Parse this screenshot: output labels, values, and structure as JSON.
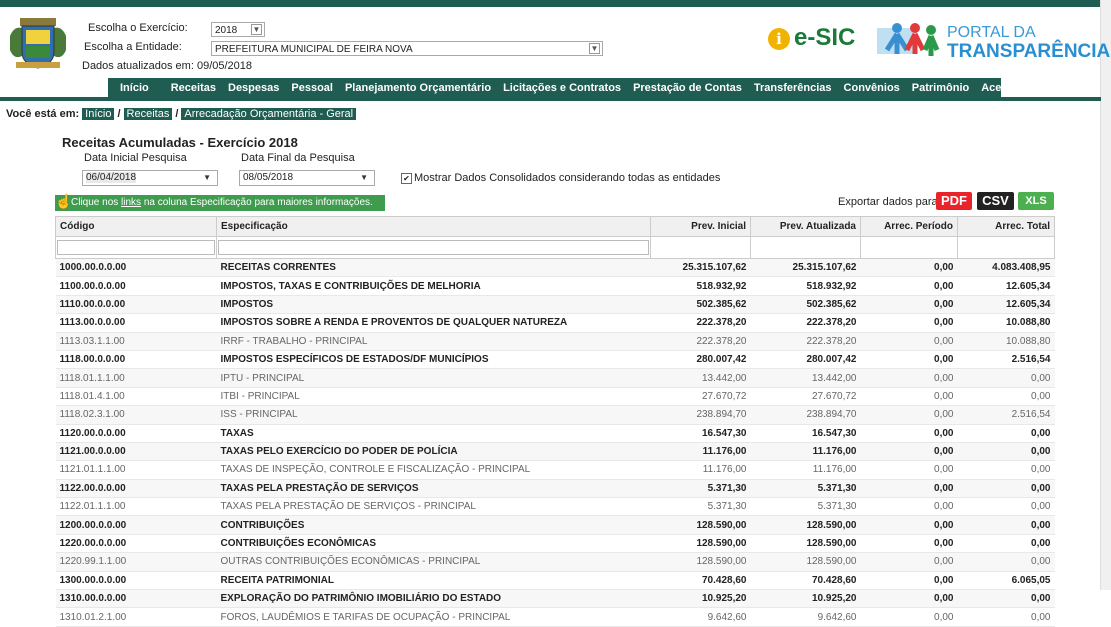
{
  "header": {
    "exercicio_label": "Escolha o Exercício:",
    "exercicio_value": "2018",
    "entidade_label": "Escolha a Entidade:",
    "entidade_value": "PREFEITURA MUNICIPAL DE FEIRA NOVA",
    "updated": "Dados atualizados em: 09/05/2018",
    "esic": "e-SIC",
    "portal_line1": "PORTAL DA",
    "portal_line2": "TRANSPARÊNCIA"
  },
  "nav": [
    "Início",
    "Receitas",
    "Despesas",
    "Pessoal",
    "Planejamento Orçamentário",
    "Licitações e Contratos",
    "Prestação de Contas",
    "Transferências",
    "Convênios",
    "Patrimônio",
    "Acesso à Informação"
  ],
  "breadcrumb": {
    "label": "Você está em:",
    "items": [
      "Início",
      "Receitas",
      "Arrecadação Orçamentária - Geral"
    ]
  },
  "page": {
    "title": "Receitas Acumuladas - Exercício 2018",
    "data_inicial_label": "Data Inicial Pesquisa",
    "data_inicial": "06/04/2018",
    "data_final_label": "Data Final da Pesquisa",
    "data_final": "08/05/2018",
    "consolidado_label": "Mostrar Dados Consolidados considerando todas as entidades",
    "hint_pre": "Clique nos ",
    "hint_link": "links",
    "hint_post": " na coluna Especificação para maiores informações.",
    "export_label": "Exportar dados para:",
    "pdf": "PDF",
    "csv": "CSV",
    "xls": "XLS"
  },
  "colors": {
    "brand": "#1f5c52",
    "hint": "#3f9b4d",
    "pdf": "#e8232a",
    "csv": "#222222",
    "xls": "#4caf50"
  },
  "table": {
    "headers": [
      "Código",
      "Especificação",
      "Prev. Inicial",
      "Prev. Atualizada",
      "Arrec. Período",
      "Arrec. Total"
    ],
    "rows": [
      {
        "b": true,
        "c": [
          "1000.00.0.0.00",
          "RECEITAS CORRENTES",
          "25.315.107,62",
          "25.315.107,62",
          "0,00",
          "4.083.408,95"
        ]
      },
      {
        "b": true,
        "c": [
          "1100.00.0.0.00",
          "IMPOSTOS, TAXAS E CONTRIBUIÇÕES DE MELHORIA",
          "518.932,92",
          "518.932,92",
          "0,00",
          "12.605,34"
        ]
      },
      {
        "b": true,
        "c": [
          "1110.00.0.0.00",
          "IMPOSTOS",
          "502.385,62",
          "502.385,62",
          "0,00",
          "12.605,34"
        ]
      },
      {
        "b": true,
        "c": [
          "1113.00.0.0.00",
          "IMPOSTOS SOBRE A RENDA E PROVENTOS DE QUALQUER NATUREZA",
          "222.378,20",
          "222.378,20",
          "0,00",
          "10.088,80"
        ]
      },
      {
        "b": false,
        "c": [
          "1113.03.1.1.00",
          "IRRF - TRABALHO - PRINCIPAL",
          "222.378,20",
          "222.378,20",
          "0,00",
          "10.088,80"
        ]
      },
      {
        "b": true,
        "c": [
          "1118.00.0.0.00",
          "IMPOSTOS ESPECÍFICOS DE ESTADOS/DF MUNICÍPIOS",
          "280.007,42",
          "280.007,42",
          "0,00",
          "2.516,54"
        ]
      },
      {
        "b": false,
        "c": [
          "1118.01.1.1.00",
          "IPTU - PRINCIPAL",
          "13.442,00",
          "13.442,00",
          "0,00",
          "0,00"
        ]
      },
      {
        "b": false,
        "c": [
          "1118.01.4.1.00",
          "ITBI - PRINCIPAL",
          "27.670,72",
          "27.670,72",
          "0,00",
          "0,00"
        ]
      },
      {
        "b": false,
        "c": [
          "1118.02.3.1.00",
          "ISS - PRINCIPAL",
          "238.894,70",
          "238.894,70",
          "0,00",
          "2.516,54"
        ]
      },
      {
        "b": true,
        "c": [
          "1120.00.0.0.00",
          "TAXAS",
          "16.547,30",
          "16.547,30",
          "0,00",
          "0,00"
        ]
      },
      {
        "b": true,
        "c": [
          "1121.00.0.0.00",
          "TAXAS PELO EXERCÍCIO DO PODER DE POLÍCIA",
          "11.176,00",
          "11.176,00",
          "0,00",
          "0,00"
        ]
      },
      {
        "b": false,
        "c": [
          "1121.01.1.1.00",
          "TAXAS DE INSPEÇÃO, CONTROLE E FISCALIZAÇÃO - PRINCIPAL",
          "11.176,00",
          "11.176,00",
          "0,00",
          "0,00"
        ]
      },
      {
        "b": true,
        "c": [
          "1122.00.0.0.00",
          "TAXAS PELA PRESTAÇÃO DE SERVIÇOS",
          "5.371,30",
          "5.371,30",
          "0,00",
          "0,00"
        ]
      },
      {
        "b": false,
        "c": [
          "1122.01.1.1.00",
          "TAXAS PELA PRESTAÇÃO DE SERVIÇOS - PRINCIPAL",
          "5.371,30",
          "5.371,30",
          "0,00",
          "0,00"
        ]
      },
      {
        "b": true,
        "c": [
          "1200.00.0.0.00",
          "CONTRIBUIÇÕES",
          "128.590,00",
          "128.590,00",
          "0,00",
          "0,00"
        ]
      },
      {
        "b": true,
        "c": [
          "1220.00.0.0.00",
          "CONTRIBUIÇÕES ECONÔMICAS",
          "128.590,00",
          "128.590,00",
          "0,00",
          "0,00"
        ]
      },
      {
        "b": false,
        "c": [
          "1220.99.1.1.00",
          "OUTRAS CONTRIBUIÇÕES ECONÔMICAS - PRINCIPAL",
          "128.590,00",
          "128.590,00",
          "0,00",
          "0,00"
        ]
      },
      {
        "b": true,
        "c": [
          "1300.00.0.0.00",
          "RECEITA PATRIMONIAL",
          "70.428,60",
          "70.428,60",
          "0,00",
          "6.065,05"
        ]
      },
      {
        "b": true,
        "c": [
          "1310.00.0.0.00",
          "EXPLORAÇÃO DO PATRIMÔNIO IMOBILIÁRIO DO ESTADO",
          "10.925,20",
          "10.925,20",
          "0,00",
          "0,00"
        ]
      },
      {
        "b": false,
        "c": [
          "1310.01.2.1.00",
          "FOROS, LAUDÊMIOS E TARIFAS DE OCUPAÇÃO - PRINCIPAL",
          "9.642,60",
          "9.642,60",
          "0,00",
          "0,00"
        ]
      }
    ]
  }
}
